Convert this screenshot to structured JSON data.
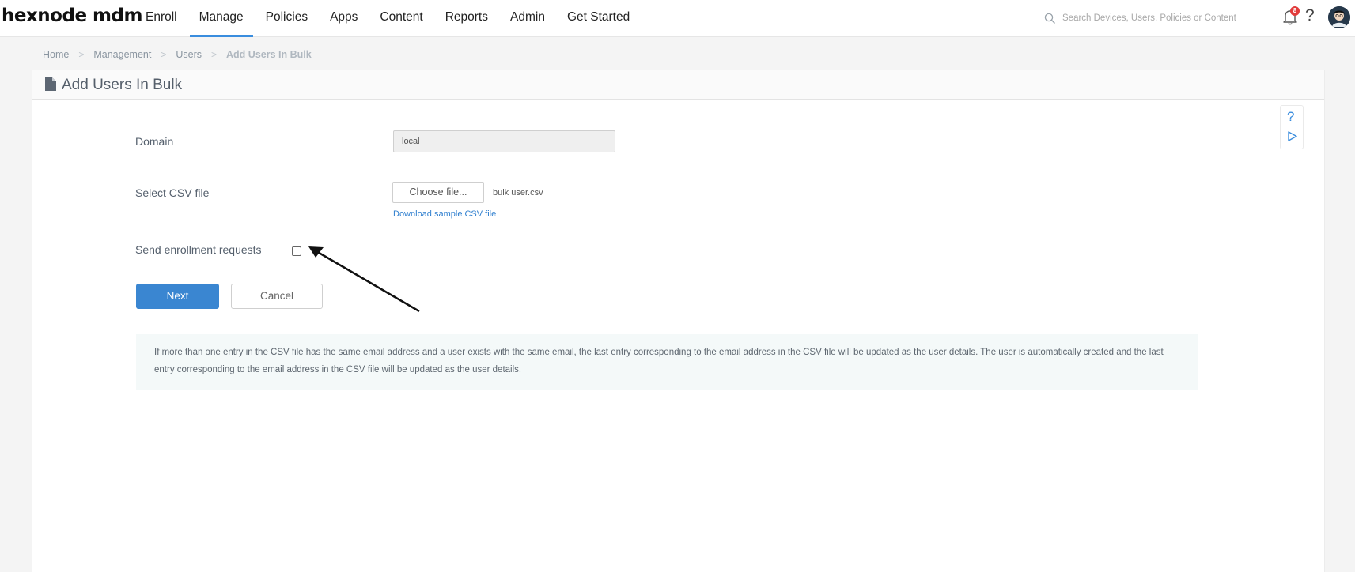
{
  "app": {
    "logo": "hexnode mdm"
  },
  "nav": {
    "items": [
      {
        "label": "Enroll",
        "active": false
      },
      {
        "label": "Manage",
        "active": true
      },
      {
        "label": "Policies",
        "active": false
      },
      {
        "label": "Apps",
        "active": false
      },
      {
        "label": "Content",
        "active": false
      },
      {
        "label": "Reports",
        "active": false
      },
      {
        "label": "Admin",
        "active": false
      },
      {
        "label": "Get Started",
        "active": false
      }
    ]
  },
  "search": {
    "placeholder": "Search Devices, Users, Policies or Content",
    "icon": "search-icon"
  },
  "notifications": {
    "count": "8",
    "icon": "bell-icon"
  },
  "help": {
    "label": "?"
  },
  "breadcrumb": [
    "Home",
    "Management",
    "Users",
    "Add Users In Bulk"
  ],
  "page": {
    "title": "Add Users In Bulk",
    "icon": "document-icon"
  },
  "side_help": {
    "question": "?",
    "play_icon": "play-icon"
  },
  "form": {
    "domain_label": "Domain",
    "domain_value": "local",
    "csv_label": "Select CSV file",
    "choose_file_label": "Choose file...",
    "file_name": "bulk user.csv",
    "sample_link": "Download sample CSV file",
    "enroll_label": "Send enrollment requests",
    "enroll_checked": false
  },
  "actions": {
    "next": "Next",
    "cancel": "Cancel"
  },
  "note": "If more than one entry in the CSV file has the same email address and a user exists with the same email, the last entry corresponding to the email address in the CSV file will be updated as the user details. The user is automatically created and the last entry corresponding to the email address in the CSV file will be updated as the user details.",
  "colors": {
    "accent": "#3a86d1",
    "badge": "#e23b3b",
    "note_bg": "#f4f9f9"
  }
}
